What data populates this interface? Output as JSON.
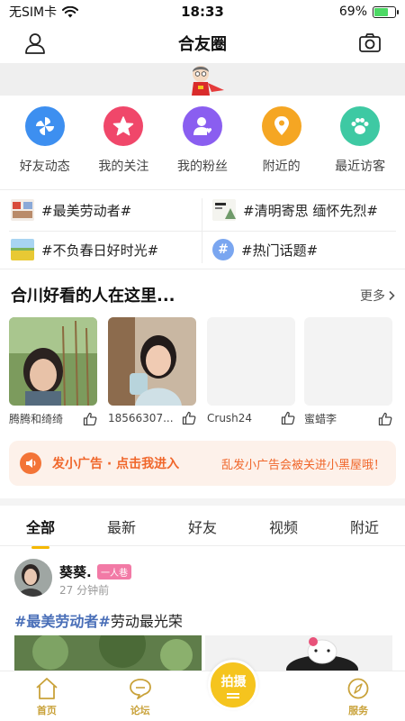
{
  "status_bar": {
    "carrier": "无SIM卡",
    "time": "18:33",
    "battery": "69%",
    "battery_level": 0.69
  },
  "header": {
    "title": "合友圈"
  },
  "quick_icons": [
    {
      "label": "好友动态",
      "icon": "pinwheel-icon",
      "color": "#3d8ff0"
    },
    {
      "label": "我的关注",
      "icon": "star-icon",
      "color": "#f0476a"
    },
    {
      "label": "我的粉丝",
      "icon": "user-heart-icon",
      "color": "#8a5ef0"
    },
    {
      "label": "附近的",
      "icon": "location-pin-icon",
      "color": "#f5a623"
    },
    {
      "label": "最近访客",
      "icon": "paw-icon",
      "color": "#3ec9a3"
    }
  ],
  "topics": [
    {
      "label": "#最美劳动者#"
    },
    {
      "label": "#清明寄思 缅怀先烈#"
    },
    {
      "label": "#不负春日好时光#"
    },
    {
      "label": "#热门话题#"
    }
  ],
  "people_section": {
    "title": "合川好看的人在这里...",
    "more": "更多"
  },
  "people": [
    {
      "name": "腾腾和绮绮"
    },
    {
      "name": "18566307..."
    },
    {
      "name": "Crush24"
    },
    {
      "name": "蜜蜡李"
    }
  ],
  "ad": {
    "main": "发小广告 · 点击我进入",
    "note": "乱发小广告会被关进小黑屋哦！"
  },
  "tabs": [
    "全部",
    "最新",
    "好友",
    "视频",
    "附近"
  ],
  "post": {
    "user": "葵葵.",
    "badge": "一人巷",
    "time": "27 分钟前",
    "tag": "#最美劳动者#",
    "text": "劳动最光荣"
  },
  "bottom_nav": {
    "home": "首页",
    "forum": "论坛",
    "shoot": "拍摄",
    "service": "服务"
  },
  "colors": {
    "accent": "#f5b800",
    "nav": "#c9a23a",
    "ad": "#f0662a"
  }
}
